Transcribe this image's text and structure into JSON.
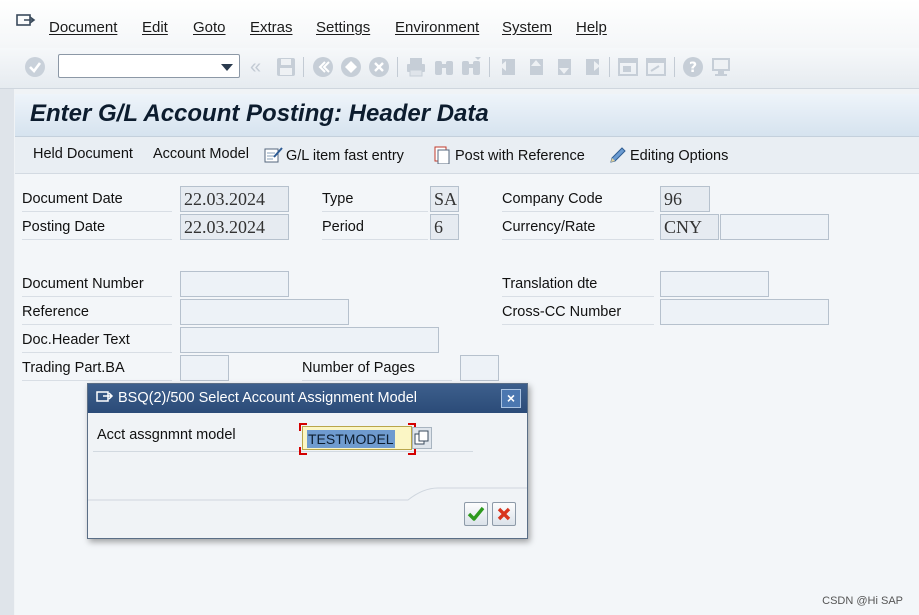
{
  "menubar": {
    "items": [
      {
        "label": "Document"
      },
      {
        "label": "Edit"
      },
      {
        "label": "Goto"
      },
      {
        "label": "Extras"
      },
      {
        "label": "Settings"
      },
      {
        "label": "Environment"
      },
      {
        "label": "System"
      },
      {
        "label": "Help"
      }
    ]
  },
  "toolbar": {
    "command_field_value": "",
    "icons": [
      "enter-icon",
      "back-nav-icon",
      "save-icon",
      "back-icon",
      "exit-icon",
      "cancel-icon",
      "print-icon",
      "find-icon",
      "find-next-icon",
      "first-page-icon",
      "previous-page-icon",
      "next-page-icon",
      "last-page-icon",
      "create-session-icon",
      "shortcut-icon",
      "help-icon",
      "customize-layout-icon"
    ]
  },
  "page": {
    "title": "Enter G/L Account Posting: Header Data"
  },
  "app_toolbar": {
    "held_document": "Held Document",
    "account_model": "Account Model",
    "gl_fast_entry": "G/L item fast entry",
    "post_with_reference": "Post with Reference",
    "editing_options": "Editing Options"
  },
  "form": {
    "document_date": {
      "label": "Document Date",
      "value": "22.03.2024"
    },
    "posting_date": {
      "label": "Posting Date",
      "value": "22.03.2024"
    },
    "type": {
      "label": "Type",
      "value": "SA"
    },
    "period": {
      "label": "Period",
      "value": "6"
    },
    "company_code": {
      "label": "Company Code",
      "value": "96"
    },
    "currency_rate": {
      "label": "Currency/Rate",
      "value": "CNY",
      "rate": ""
    },
    "document_number": {
      "label": "Document Number",
      "value": ""
    },
    "reference": {
      "label": "Reference",
      "value": ""
    },
    "doc_header_text": {
      "label": "Doc.Header Text",
      "value": ""
    },
    "trading_part_ba": {
      "label": "Trading Part.BA",
      "value": ""
    },
    "number_of_pages": {
      "label": "Number of Pages",
      "value": ""
    },
    "translation_date": {
      "label": "Translation dte",
      "value": ""
    },
    "cross_cc_number": {
      "label": "Cross-CC Number",
      "value": ""
    }
  },
  "dialog": {
    "title": "BSQ(2)/500 Select Account Assignment Model",
    "field_label": "Acct assgnmnt model",
    "field_value": "TESTMODEL",
    "close_label": "×"
  },
  "watermark": "CSDN @Hi SAP",
  "colors": {
    "title_bar": "#dbe6f1",
    "dialog_title": "#2e4e7c",
    "input_focus": "#fbf6c5",
    "selection": "#6f9bcf",
    "confirm_green": "#2e9a1e",
    "cancel_red": "#d8351e"
  }
}
